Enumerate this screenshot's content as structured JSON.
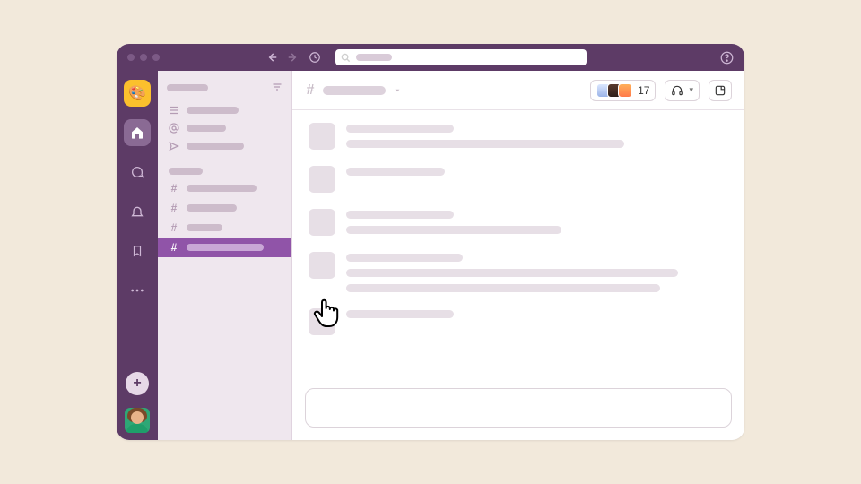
{
  "titlebar": {
    "search_placeholder": "Search"
  },
  "rail": {
    "workspace_emoji": "🎨",
    "add_label": "+"
  },
  "sidebar": {
    "top_items": [
      {
        "icon": "threads"
      },
      {
        "icon": "mentions"
      },
      {
        "icon": "drafts"
      }
    ],
    "channels": [
      {
        "active": false
      },
      {
        "active": false
      },
      {
        "active": false
      },
      {
        "active": true
      }
    ]
  },
  "header": {
    "member_count": "17"
  },
  "messages": [
    {
      "lines": [
        120,
        310
      ]
    },
    {
      "lines": [
        110
      ]
    },
    {
      "lines": [
        120,
        240
      ]
    },
    {
      "lines": [
        130,
        370,
        350
      ]
    },
    {
      "lines": [
        120
      ]
    }
  ]
}
